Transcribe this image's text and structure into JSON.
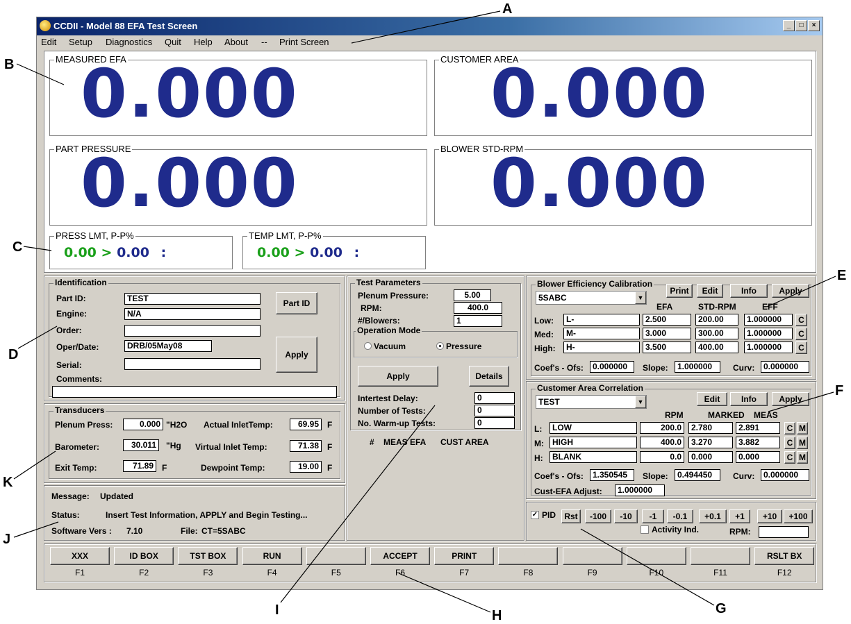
{
  "callouts": {
    "a": "A",
    "b": "B",
    "c": "C",
    "d": "D",
    "e": "E",
    "f": "F",
    "g": "G",
    "h": "H",
    "i": "I",
    "j": "J",
    "k": "K"
  },
  "window": {
    "title": "CCDII - Model 88 EFA Test Screen",
    "minimize": "_",
    "restore": "□",
    "close": "×"
  },
  "menu": {
    "edit": "Edit",
    "setup": "Setup",
    "diagnostics": "Diagnostics",
    "quit": "Quit",
    "help": "Help",
    "about": "About",
    "sep": "--",
    "print_screen": "Print Screen"
  },
  "displays": {
    "measured_efa": {
      "label": "MEASURED EFA",
      "value": "0.000"
    },
    "customer_area": {
      "label": "CUSTOMER AREA",
      "value": "0.000"
    },
    "part_pressure": {
      "label": "PART PRESSURE",
      "value": "0.000"
    },
    "blower_std_rpm": {
      "label": "BLOWER STD-RPM",
      "value": "0.000"
    }
  },
  "limits": {
    "press": {
      "label": "PRESS LMT, P-P%",
      "v1": "0.00",
      "op": ">",
      "v2": "0.00",
      "sep": ":"
    },
    "temp": {
      "label": "TEMP LMT, P-P%",
      "v1": "0.00",
      "op": ">",
      "v2": "0.00",
      "sep": ":"
    }
  },
  "identification": {
    "title": "Identification",
    "part_id_label": "Part ID:",
    "part_id": "TEST",
    "engine_label": "Engine:",
    "engine": "N/A",
    "order_label": "Order:",
    "order": "",
    "oper_date_label": "Oper/Date:",
    "oper_date": "DRB/05May08",
    "serial_label": "Serial:",
    "serial": "",
    "comments_label": "Comments:",
    "comments": "",
    "part_id_button": "Part ID",
    "apply_button": "Apply"
  },
  "transducers": {
    "title": "Transducers",
    "plenum_label": "Plenum Press:",
    "plenum": "0.000",
    "plenum_unit": "\"H2O",
    "actual_inlet_label": "Actual InletTemp:",
    "actual_inlet": "69.95",
    "actual_inlet_unit": "F",
    "barometer_label": "Barometer:",
    "barometer": "30.011",
    "barometer_unit": "\"Hg",
    "virtual_inlet_label": "Virtual Inlet Temp:",
    "virtual_inlet": "71.38",
    "virtual_inlet_unit": "F",
    "exit_label": "Exit Temp:",
    "exit": "71.89",
    "exit_unit": "F",
    "dewpoint_label": "Dewpoint Temp:",
    "dewpoint": "19.00",
    "dewpoint_unit": "F"
  },
  "messages": {
    "message_label": "Message:",
    "message": "Updated",
    "status_label": "Status:",
    "status": "Insert Test Information, APPLY and Begin Testing...",
    "software_label": "Software Vers :",
    "software": "7.10",
    "file_label": "File:",
    "file": "CT=5SABC"
  },
  "test_params": {
    "title": "Test Parameters",
    "plenum_label": "Plenum Pressure:",
    "plenum": "5.00",
    "rpm_label": "RPM:",
    "rpm": "400.0",
    "blowers_label": "#/Blowers:",
    "blowers": "1",
    "mode_title": "Operation Mode",
    "vacuum": "Vacuum",
    "pressure": "Pressure",
    "apply_button": "Apply",
    "details_button": "Details",
    "intertest_label": "Intertest Delay:",
    "intertest": "0",
    "num_tests_label": "Number of Tests:",
    "num_tests": "0",
    "warmup_label": "No. Warm-up Tests:",
    "warmup": "0",
    "col_num": "#",
    "col_meas_efa": "MEAS EFA",
    "col_cust_area": "CUST AREA"
  },
  "blower_cal": {
    "title": "Blower Efficiency Calibration",
    "selected": "5SABC",
    "print_button": "Print",
    "edit_button": "Edit",
    "info_button": "Info",
    "apply_button": "Apply",
    "col_efa": "EFA",
    "col_std_rpm": "STD-RPM",
    "col_eff": "EFF",
    "rows": [
      {
        "label": "Low:",
        "name": "L-",
        "efa": "2.500",
        "rpm": "200.00",
        "eff": "1.000000",
        "c": "C"
      },
      {
        "label": "Med:",
        "name": "M-",
        "efa": "3.000",
        "rpm": "300.00",
        "eff": "1.000000",
        "c": "C"
      },
      {
        "label": "High:",
        "name": "H-",
        "efa": "3.500",
        "rpm": "400.00",
        "eff": "1.000000",
        "c": "C"
      }
    ],
    "coef_label": "Coef's - Ofs:",
    "ofs": "0.000000",
    "slope_label": "Slope:",
    "slope": "1.000000",
    "curv_label": "Curv:",
    "curv": "0.000000"
  },
  "cust_area": {
    "title": "Customer Area Correlation",
    "selected": "TEST",
    "edit_button": "Edit",
    "info_button": "Info",
    "apply_button": "Apply",
    "col_rpm": "RPM",
    "col_marked": "MARKED",
    "col_meas": "MEAS",
    "rows": [
      {
        "label": "L:",
        "name": "LOW",
        "rpm": "200.0",
        "marked": "2.780",
        "meas": "2.891",
        "c": "C",
        "m": "M"
      },
      {
        "label": "M:",
        "name": "HIGH",
        "rpm": "400.0",
        "marked": "3.270",
        "meas": "3.882",
        "c": "C",
        "m": "M"
      },
      {
        "label": "H:",
        "name": "BLANK",
        "rpm": "0.0",
        "marked": "0.000",
        "meas": "0.000",
        "c": "C",
        "m": "M"
      }
    ],
    "coef_label": "Coef's - Ofs:",
    "ofs": "1.350545",
    "slope_label": "Slope:",
    "slope": "0.494450",
    "curv_label": "Curv:",
    "curv": "0.000000",
    "adjust_label": "Cust-EFA Adjust:",
    "adjust": "1.000000"
  },
  "pid": {
    "label": "PID",
    "checked": "✓",
    "rst": "Rst",
    "m100": "-100",
    "m10": "-10",
    "m1": "-1",
    "m01": "-0.1",
    "p01": "+0.1",
    "p1": "+1",
    "p10": "+10",
    "p100": "+100",
    "activity_label": "Activity Ind.",
    "rpm_label": "RPM:",
    "rpm": ""
  },
  "fkeys": [
    {
      "label": "XXX",
      "key": "F1"
    },
    {
      "label": "ID BOX",
      "key": "F2"
    },
    {
      "label": "TST BOX",
      "key": "F3"
    },
    {
      "label": "RUN",
      "key": "F4"
    },
    {
      "label": "",
      "key": "F5"
    },
    {
      "label": "ACCEPT",
      "key": "F6"
    },
    {
      "label": "PRINT",
      "key": "F7"
    },
    {
      "label": "",
      "key": "F8"
    },
    {
      "label": "",
      "key": "F9"
    },
    {
      "label": "",
      "key": "F10"
    },
    {
      "label": "",
      "key": "F11"
    },
    {
      "label": "RSLT BX",
      "key": "F12"
    }
  ]
}
